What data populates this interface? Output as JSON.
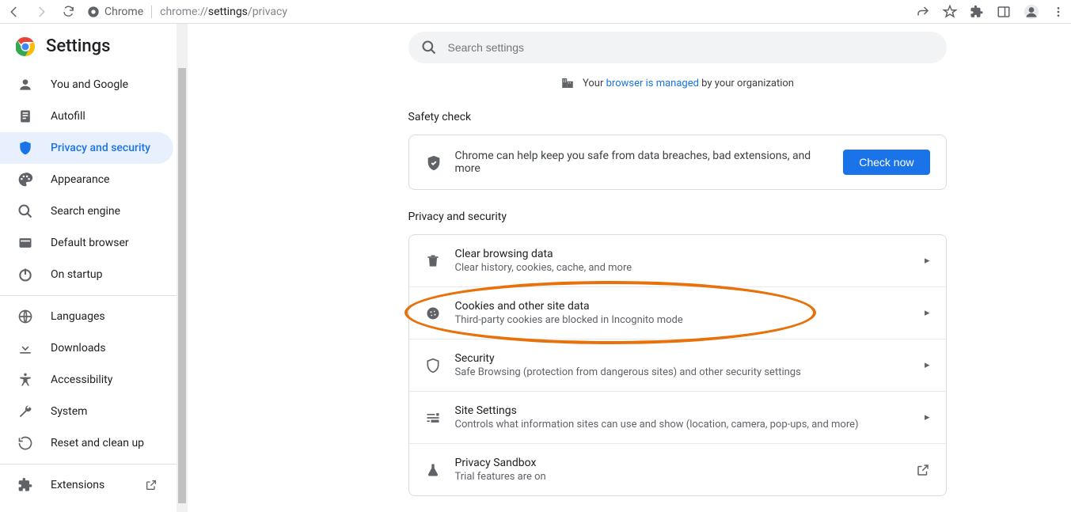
{
  "browser": {
    "chrome_label": "Chrome",
    "url_prefix": "chrome://",
    "url_bold": "settings",
    "url_rest": "/privacy"
  },
  "sidebar": {
    "title": "Settings",
    "items": [
      {
        "label": "You and Google"
      },
      {
        "label": "Autofill"
      },
      {
        "label": "Privacy and security"
      },
      {
        "label": "Appearance"
      },
      {
        "label": "Search engine"
      },
      {
        "label": "Default browser"
      },
      {
        "label": "On startup"
      }
    ],
    "advanced": [
      {
        "label": "Languages"
      },
      {
        "label": "Downloads"
      },
      {
        "label": "Accessibility"
      },
      {
        "label": "System"
      },
      {
        "label": "Reset and clean up"
      }
    ],
    "extensions_label": "Extensions"
  },
  "search": {
    "placeholder": "Search settings"
  },
  "managed": {
    "prefix": "Your ",
    "link": "browser is managed",
    "suffix": " by your organization"
  },
  "safety": {
    "heading": "Safety check",
    "text": "Chrome can help keep you safe from data breaches, bad extensions, and more",
    "button": "Check now"
  },
  "privacy": {
    "heading": "Privacy and security",
    "rows": [
      {
        "title": "Clear browsing data",
        "sub": "Clear history, cookies, cache, and more"
      },
      {
        "title": "Cookies and other site data",
        "sub": "Third-party cookies are blocked in Incognito mode"
      },
      {
        "title": "Security",
        "sub": "Safe Browsing (protection from dangerous sites) and other security settings"
      },
      {
        "title": "Site Settings",
        "sub": "Controls what information sites can use and show (location, camera, pop-ups, and more)"
      },
      {
        "title": "Privacy Sandbox",
        "sub": "Trial features are on"
      }
    ]
  }
}
